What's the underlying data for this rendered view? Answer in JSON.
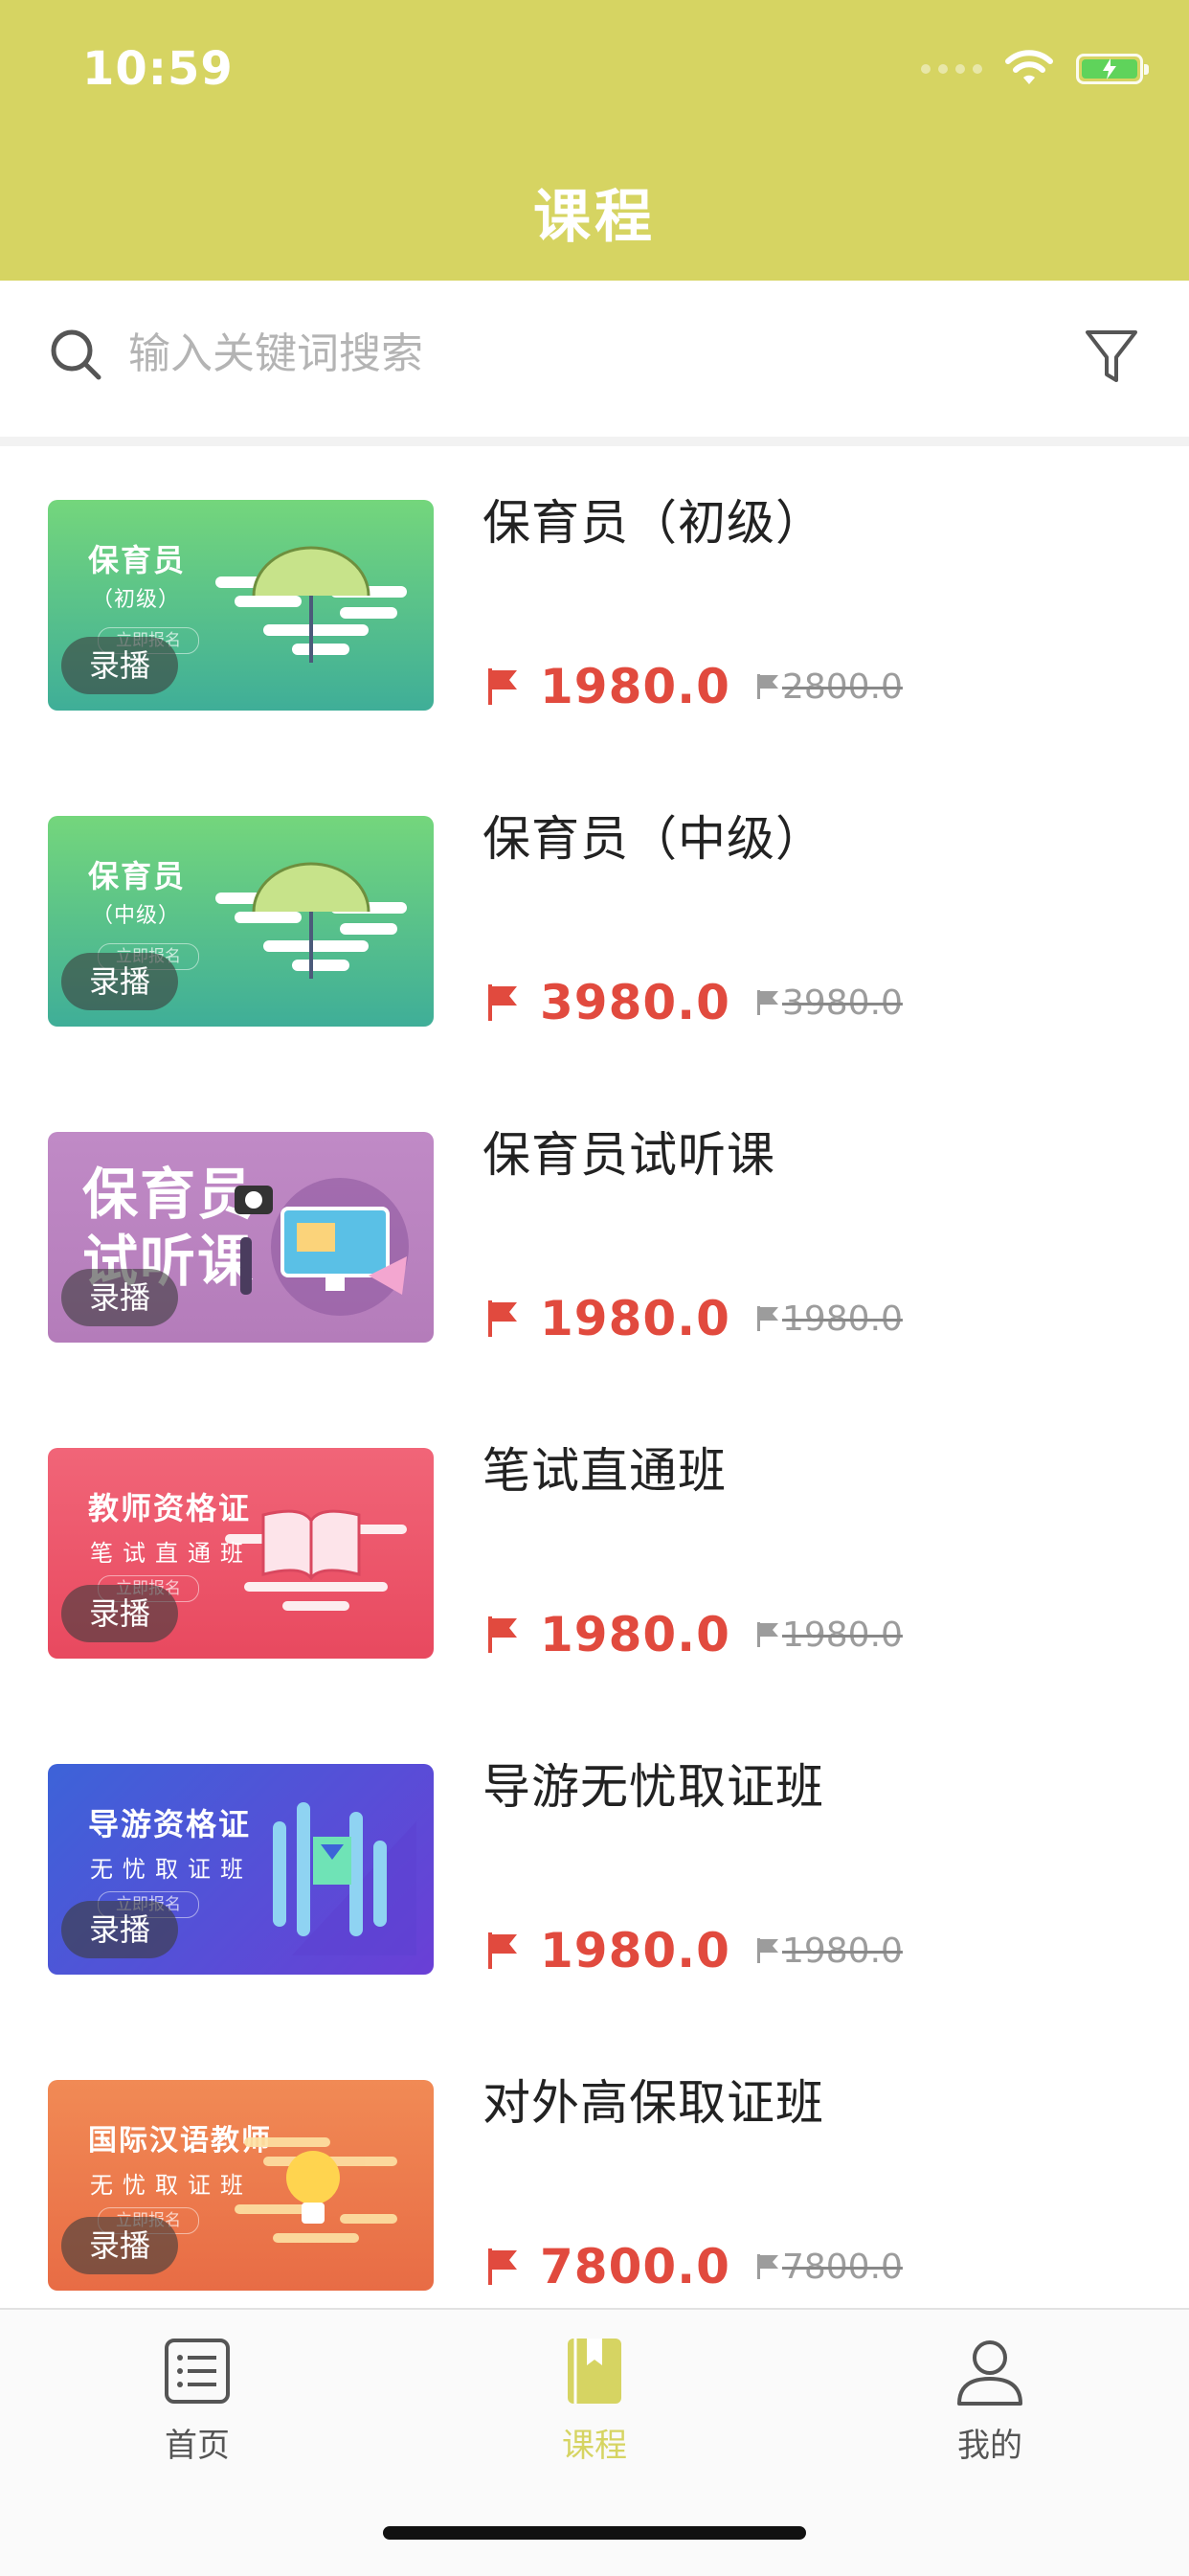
{
  "status_bar": {
    "time": "10:59"
  },
  "header": {
    "title": "课程"
  },
  "search": {
    "placeholder": "输入关键词搜索"
  },
  "colors": {
    "accent": "#d6d462",
    "price": "#e14a3e"
  },
  "courses": [
    {
      "name": "保育员（初级）",
      "price": "1980.0",
      "original_price": "2800.0",
      "tag": "录播",
      "thumb": {
        "title": "保育员",
        "subtitle": "（初级）",
        "signup": "立即报名",
        "color_top": "#74d67c",
        "color_bottom": "#3fae98",
        "icon": "umbrella-icon"
      }
    },
    {
      "name": "保育员（中级）",
      "price": "3980.0",
      "original_price": "3980.0",
      "tag": "录播",
      "thumb": {
        "title": "保育员",
        "subtitle": "（中级）",
        "signup": "立即报名",
        "color_top": "#74d67c",
        "color_bottom": "#3fae98",
        "icon": "umbrella-icon"
      }
    },
    {
      "name": "保育员试听课",
      "price": "1980.0",
      "original_price": "1980.0",
      "tag": "录播",
      "thumb": {
        "title_line1": "保育员",
        "title_line2": "试听课",
        "color_top": "#c08ac6",
        "color_bottom": "#b47cba",
        "icon": "computer-desk-icon"
      }
    },
    {
      "name": "笔试直通班",
      "price": "1980.0",
      "original_price": "1980.0",
      "tag": "录播",
      "thumb": {
        "title": "教师资格证",
        "subtitle": "笔试直通班",
        "signup": "立即报名",
        "color_top": "#f16578",
        "color_bottom": "#e8495f",
        "icon": "open-book-icon"
      }
    },
    {
      "name": "导游无忧取证班",
      "price": "1980.0",
      "original_price": "1980.0",
      "tag": "录播",
      "thumb": {
        "title": "导游资格证",
        "subtitle": "无忧取证班",
        "signup": "立即报名",
        "color_top": "#3d63d8",
        "color_bottom": "#6a3fd6",
        "icon": "flag-building-icon"
      }
    },
    {
      "name": "对外高保取证班",
      "price": "7800.0",
      "original_price": "7800.0",
      "tag": "录播",
      "thumb": {
        "title": "国际汉语教师",
        "subtitle": "无忧取证班",
        "signup": "立即报名",
        "color_top": "#f18a55",
        "color_bottom": "#e86c45",
        "icon": "lightbulb-icon"
      }
    }
  ],
  "tabbar": {
    "items": [
      {
        "label": "首页",
        "icon": "list-icon"
      },
      {
        "label": "课程",
        "icon": "bookmark-book-icon",
        "active": true
      },
      {
        "label": "我的",
        "icon": "user-icon"
      }
    ]
  }
}
